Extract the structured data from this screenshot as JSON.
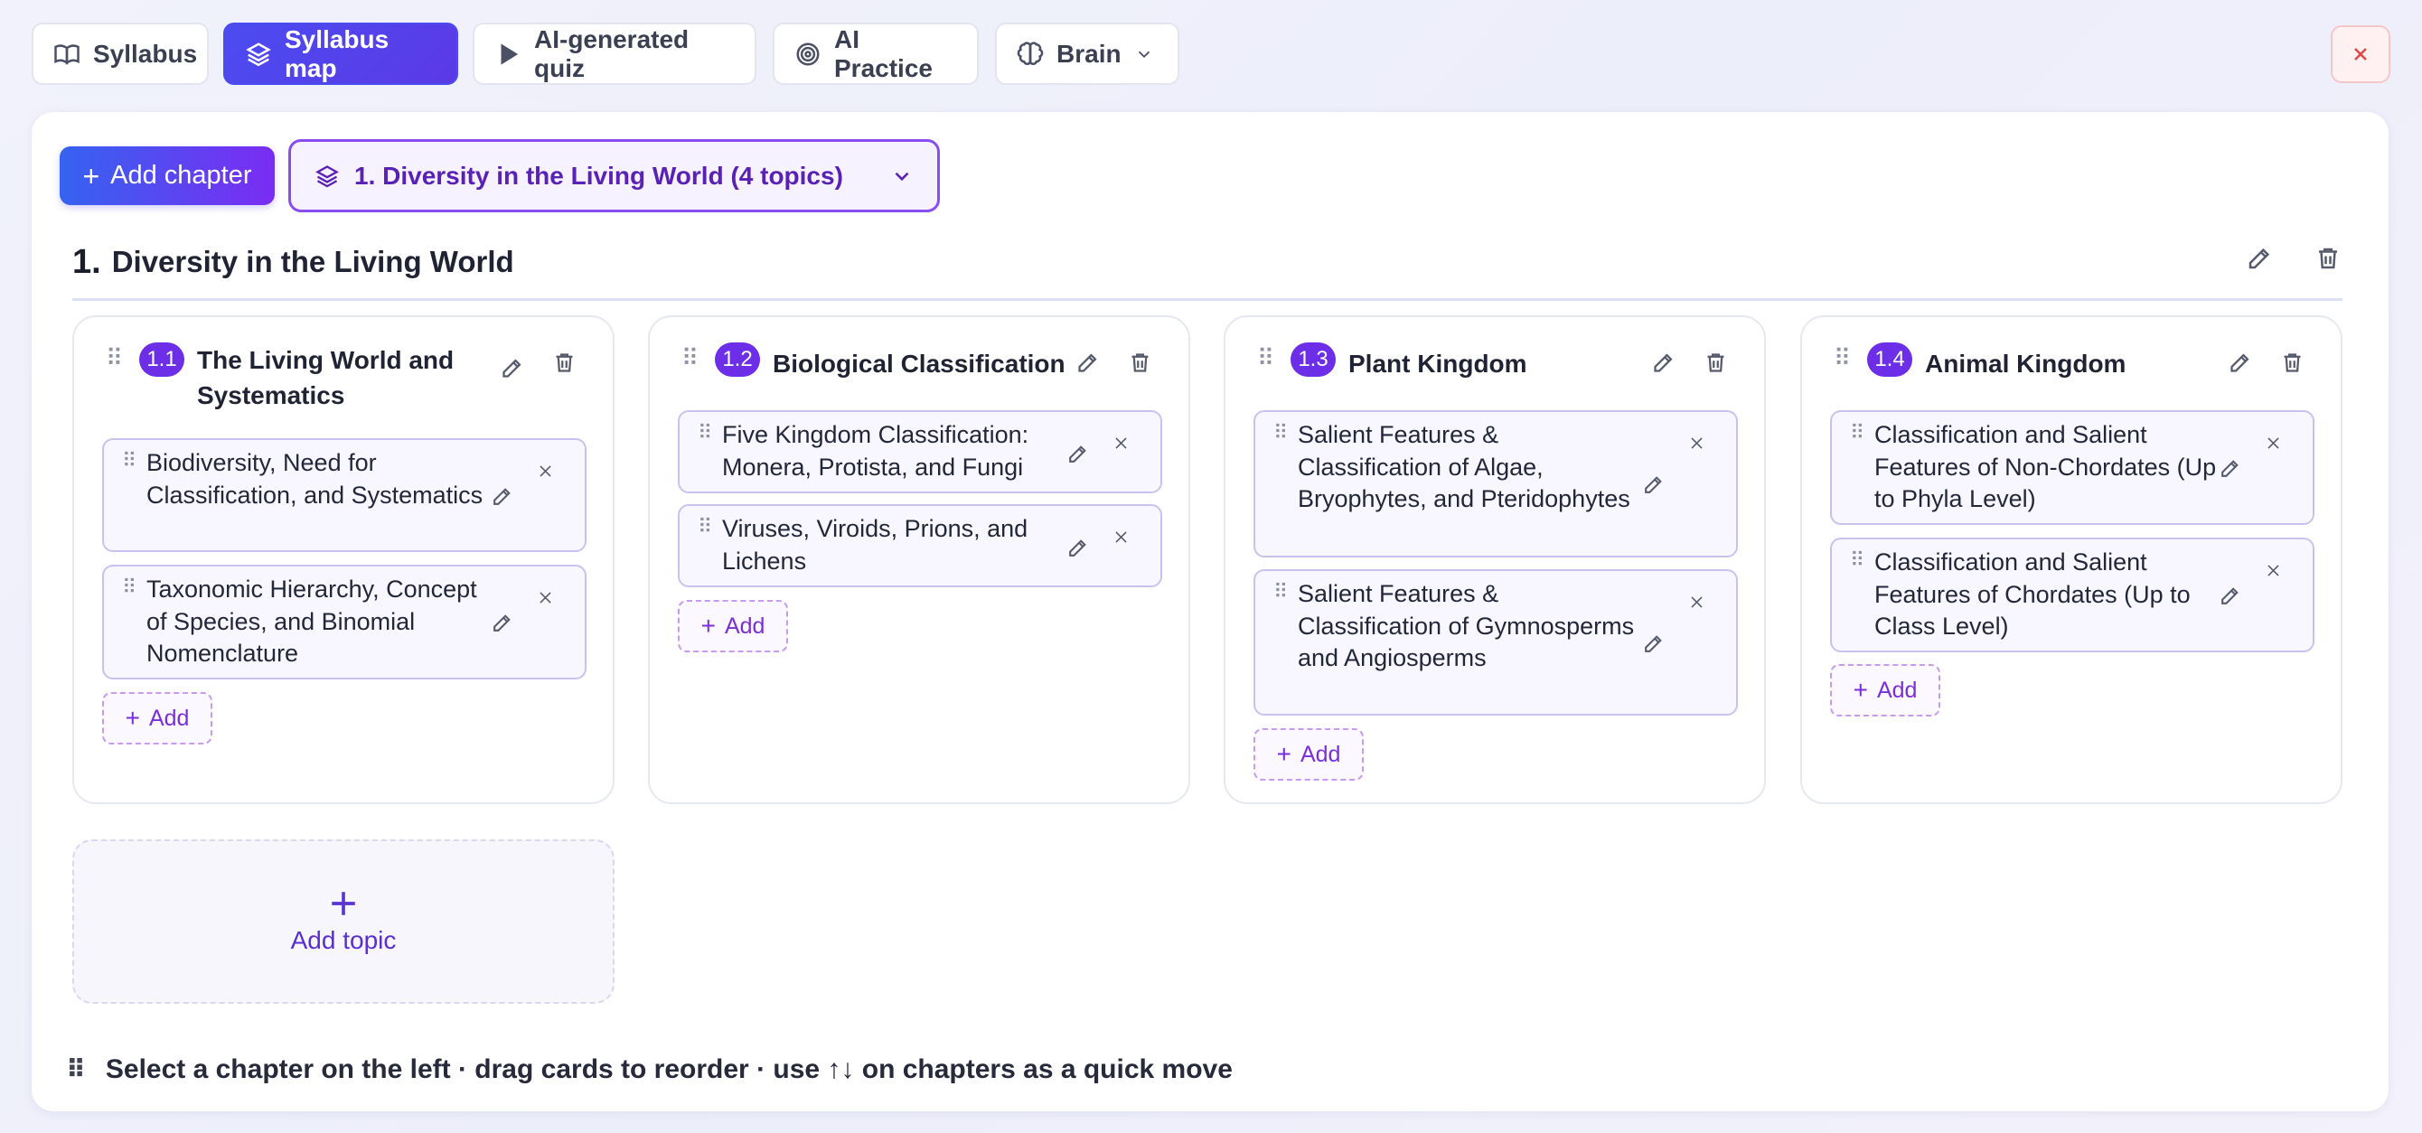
{
  "tabs": [
    {
      "label": "Syllabus",
      "icon": "book-icon",
      "active": false
    },
    {
      "label": "Syllabus map",
      "icon": "layers-icon",
      "active": true
    },
    {
      "label": "AI-generated quiz",
      "icon": "play-icon",
      "active": false
    },
    {
      "label": "AI Practice",
      "icon": "target-icon",
      "active": false
    },
    {
      "label": "Brain",
      "icon": "brain-icon",
      "active": false
    }
  ],
  "toolbar": {
    "add_chapter_label": "Add chapter",
    "chapter_select_value": "1. Diversity in the Living World (4 topics)"
  },
  "chapter": {
    "number": "1.",
    "title": "Diversity in the Living World"
  },
  "topics": [
    {
      "number": "1.1",
      "title": "The Living World and Systematics",
      "subtopics": [
        "Biodiversity, Need for Classification, and Systematics",
        "Taxonomic Hierarchy, Concept of Species, and Binomial Nomenclature"
      ],
      "add_label": "Add"
    },
    {
      "number": "1.2",
      "title": "Biological Classification",
      "subtopics": [
        "Five Kingdom Classification: Monera, Protista, and Fungi",
        "Viruses, Viroids, Prions, and Lichens"
      ],
      "add_label": "Add"
    },
    {
      "number": "1.3",
      "title": "Plant Kingdom",
      "subtopics": [
        "Salient Features & Classification of Algae, Bryophytes, and Pteridophytes",
        "Salient Features & Classification of Gymnosperms and Angiosperms"
      ],
      "add_label": "Add"
    },
    {
      "number": "1.4",
      "title": "Animal Kingdom",
      "subtopics": [
        "Classification and Salient Features of Non-Chordates (Up to Phyla Level)",
        "Classification and Salient Features of Chordates (Up to Class Level)"
      ],
      "add_label": "Add"
    }
  ],
  "add_topic_label": "Add topic",
  "hint_text": "Select a chapter on the left · drag cards to reorder · use ↑↓ on chapters as a quick move",
  "colors": {
    "accent": "#4b4cf0",
    "badge": "#6c2ee6",
    "select_border": "#8a4ef0",
    "close": "#e04848"
  }
}
